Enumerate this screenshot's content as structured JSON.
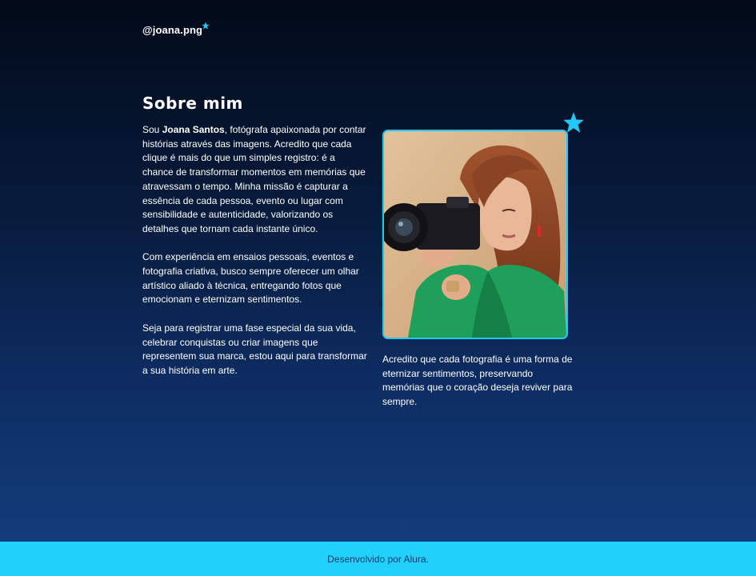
{
  "header": {
    "brand": "@joana.png",
    "accent_color": "#23c7f4"
  },
  "about": {
    "title": "Sobre mim",
    "intro_prefix": "Sou ",
    "name": "Joana Santos",
    "intro_rest": ", fotógrafa apaixonada por contar histórias através das imagens. Acredito que cada clique é mais do que um simples registro: é a chance de transformar momentos em memórias que atravessam o tempo. Minha missão é capturar a essência de cada pessoa, evento ou lugar com sensibilidade e autenticidade, valorizando os detalhes que tornam cada instante único.",
    "paragraph2": "Com experiência em ensaios pessoais, eventos e fotografia criativa, busco sempre oferecer um olhar artístico aliado à técnica, entregando fotos que emocionam e eternizam sentimentos.",
    "paragraph3": "Seja para registrar uma fase especial da sua vida, celebrar conquistas ou criar imagens que representem sua marca, estou aqui para transformar a sua história em arte."
  },
  "photo": {
    "icon": "star-icon"
  },
  "caption": "Acredito que cada fotografia é uma forma de eternizar sentimentos, preservando memórias que o coração deseja reviver para sempre.",
  "footer": {
    "text": "Desenvolvido por Alura.",
    "background_color": "#22d1fb"
  }
}
